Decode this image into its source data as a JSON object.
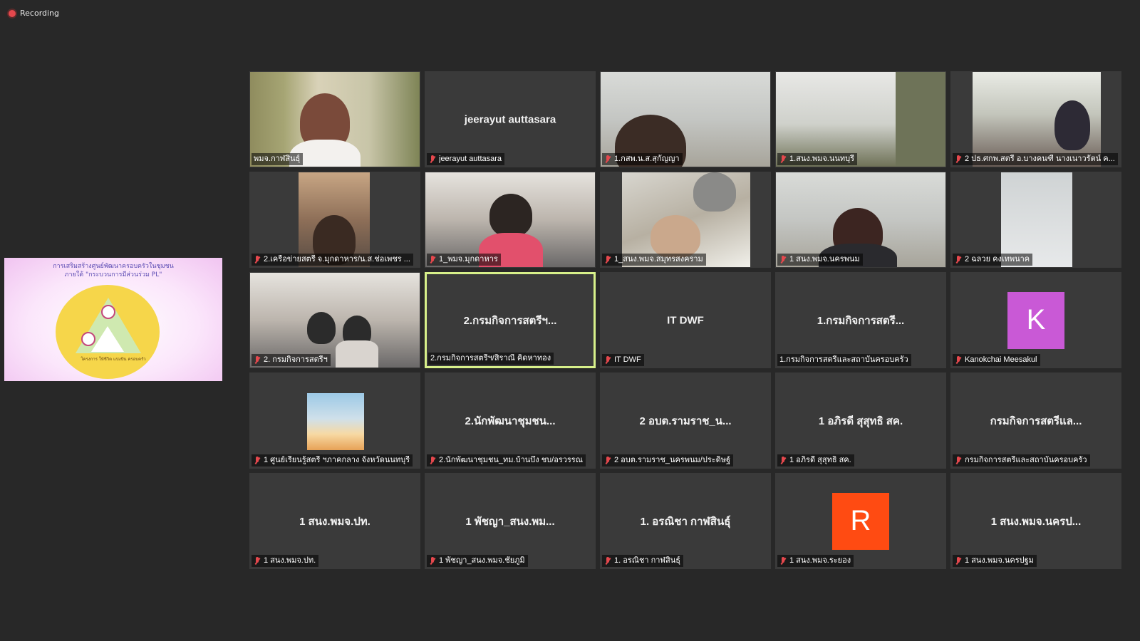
{
  "recording": {
    "label": "Recording"
  },
  "share": {
    "title_line1": "การเสริมสร้างศูนย์พัฒนาครอบครัวในชุมชน",
    "title_line2": "ภายใต้ \"กระบวนการมีส่วนร่วม PL\"",
    "footer": "โครงการ ให้ชีวิต แบ่งปัน ครอบครัว"
  },
  "tiles": [
    {
      "label": "พมจ.กาฬสินธุ์",
      "center": "",
      "muted": false
    },
    {
      "label": "jeerayut auttasara",
      "center": "jeerayut auttasara",
      "muted": true
    },
    {
      "label": "1.กสพ.น.ส.สุกัญญา",
      "center": "",
      "muted": true
    },
    {
      "label": "1.สนง.พมจ.นนทบุรี",
      "center": "",
      "muted": true
    },
    {
      "label": "2 ปธ.ศกพ.สตรี อ.บางคนฑี นางเนาวรัตน์ ค...",
      "center": "",
      "muted": true
    },
    {
      "label": "2.เครือข่ายสตรี จ.มุกดาหาร/น.ส.ช่อเพชร ...",
      "center": "",
      "muted": true
    },
    {
      "label": "1_พมจ.มุกดาหาร",
      "center": "",
      "muted": true
    },
    {
      "label": "1_สนง.พมจ.สมุทรสงคราม",
      "center": "",
      "muted": true
    },
    {
      "label": "1 สนง.พมจ.นครพนม",
      "center": "",
      "muted": true
    },
    {
      "label": "2 ฉลวย คงเทพนาค",
      "center": "",
      "muted": true
    },
    {
      "label": "2. กรมกิจการสตรีฯ",
      "center": "",
      "muted": true
    },
    {
      "label": "2.กรมกิจการสตรีฯ/สิราณี คิดหาทอง",
      "center": "2.กรมกิจการสตรีฯ...",
      "muted": false
    },
    {
      "label": "IT DWF",
      "center": "IT DWF",
      "muted": true
    },
    {
      "label": "1.กรมกิจการสตรีและสถาบันครอบครัว",
      "center": "1.กรมกิจการสตรี...",
      "muted": false
    },
    {
      "label": "Kanokchai Meesakul",
      "center": "",
      "muted": true,
      "avatar": "K"
    },
    {
      "label": "1 ศูนย์เรียนรู้สตรี ฯภาคกลาง จังหวัดนนทบุรี",
      "center": "",
      "muted": true
    },
    {
      "label": "2.นักพัฒนาชุมชน_ทม.บ้านบึง ชบ/อรวรรณ",
      "center": "2.นักพัฒนาชุมชน...",
      "muted": true
    },
    {
      "label": "2 อบต.รามราช_นครพนม/ประดิษฐ์",
      "center": "2 อบต.รามราช_น...",
      "muted": true
    },
    {
      "label": "1 อภิรดี สุสุทธิ สค.",
      "center": "1 อภิรดี สุสุทธิ สค.",
      "muted": true
    },
    {
      "label": "กรมกิจการสตรีและสถาบันครอบครัว",
      "center": "กรมกิจการสตรีแล...",
      "muted": true
    },
    {
      "label": "1 สนง.พมจ.ปท.",
      "center": "1 สนง.พมจ.ปท.",
      "muted": true
    },
    {
      "label": "1 พัชญา_สนง.พมจ.ชัยภูมิ",
      "center": "1 พัชญา_สนง.พม...",
      "muted": true
    },
    {
      "label": "1. อรณิชา กาฬสินธุ์",
      "center": "1. อรณิชา กาฬสินธุ์",
      "muted": true
    },
    {
      "label": "1 สนง.พมจ.ระยอง",
      "center": "",
      "muted": true,
      "avatar": "R"
    },
    {
      "label": "1 สนง.พมจ.นครปฐม",
      "center": "1 สนง.พมจ.นครป...",
      "muted": true
    }
  ],
  "colors": {
    "background": "#282828",
    "tile": "#3a3a3a",
    "active_border": "#d7f08a",
    "muted_mic": "#e5484d",
    "avatar_k": "#c959d6",
    "avatar_r": "#ff4b12"
  },
  "icons": {
    "muted": "mic-muted-icon",
    "recording": "recording-dot-icon"
  }
}
